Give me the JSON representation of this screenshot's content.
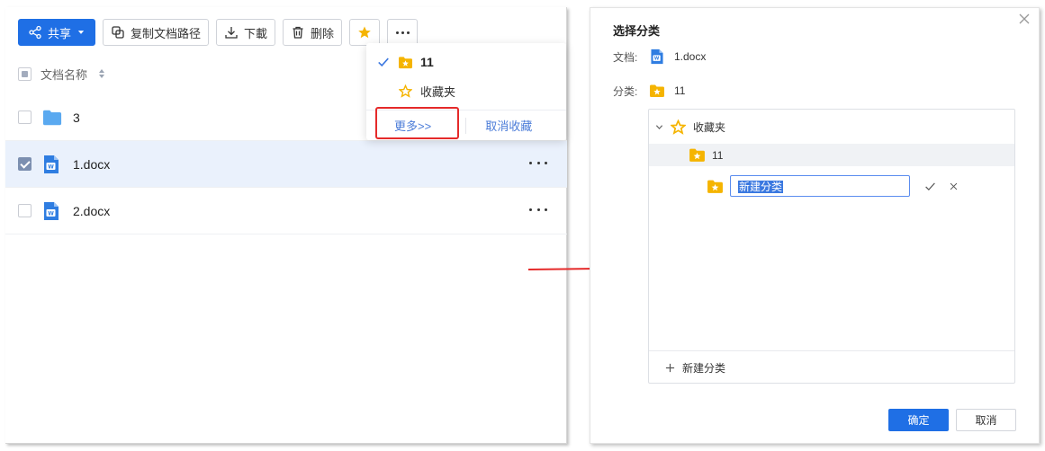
{
  "toolbar": {
    "share_label": "共享",
    "copy_path_label": "复制文档路径",
    "download_label": "下載",
    "delete_label": "删除"
  },
  "list": {
    "column_name": "文档名称",
    "rows": [
      {
        "name": "3",
        "type": "folder",
        "checked": false
      },
      {
        "name": "1.docx",
        "type": "word",
        "checked": true
      },
      {
        "name": "2.docx",
        "type": "word",
        "checked": false
      }
    ]
  },
  "dropdown": {
    "items": [
      {
        "label": "11",
        "checked": true,
        "icon": "star-folder-icon"
      },
      {
        "label": "收藏夹",
        "checked": false,
        "icon": "star-outline-icon"
      }
    ],
    "more_label": "更多>>",
    "cancel_favorite_label": "取消收藏"
  },
  "dialog": {
    "title": "选择分类",
    "doc_label": "文档:",
    "doc_value": "1.docx",
    "category_label": "分类:",
    "category_value": "11",
    "tree": {
      "root": "收藏夹",
      "child": "11",
      "new_input_value": "新建分类"
    },
    "new_category_label": "新建分类",
    "ok_label": "确定",
    "cancel_label": "取消"
  },
  "colors": {
    "primary": "#1f6fe5",
    "star": "#f5b400",
    "word": "#2f7de1",
    "folder": "#5aa9f0",
    "highlight": "#e52a2a"
  }
}
